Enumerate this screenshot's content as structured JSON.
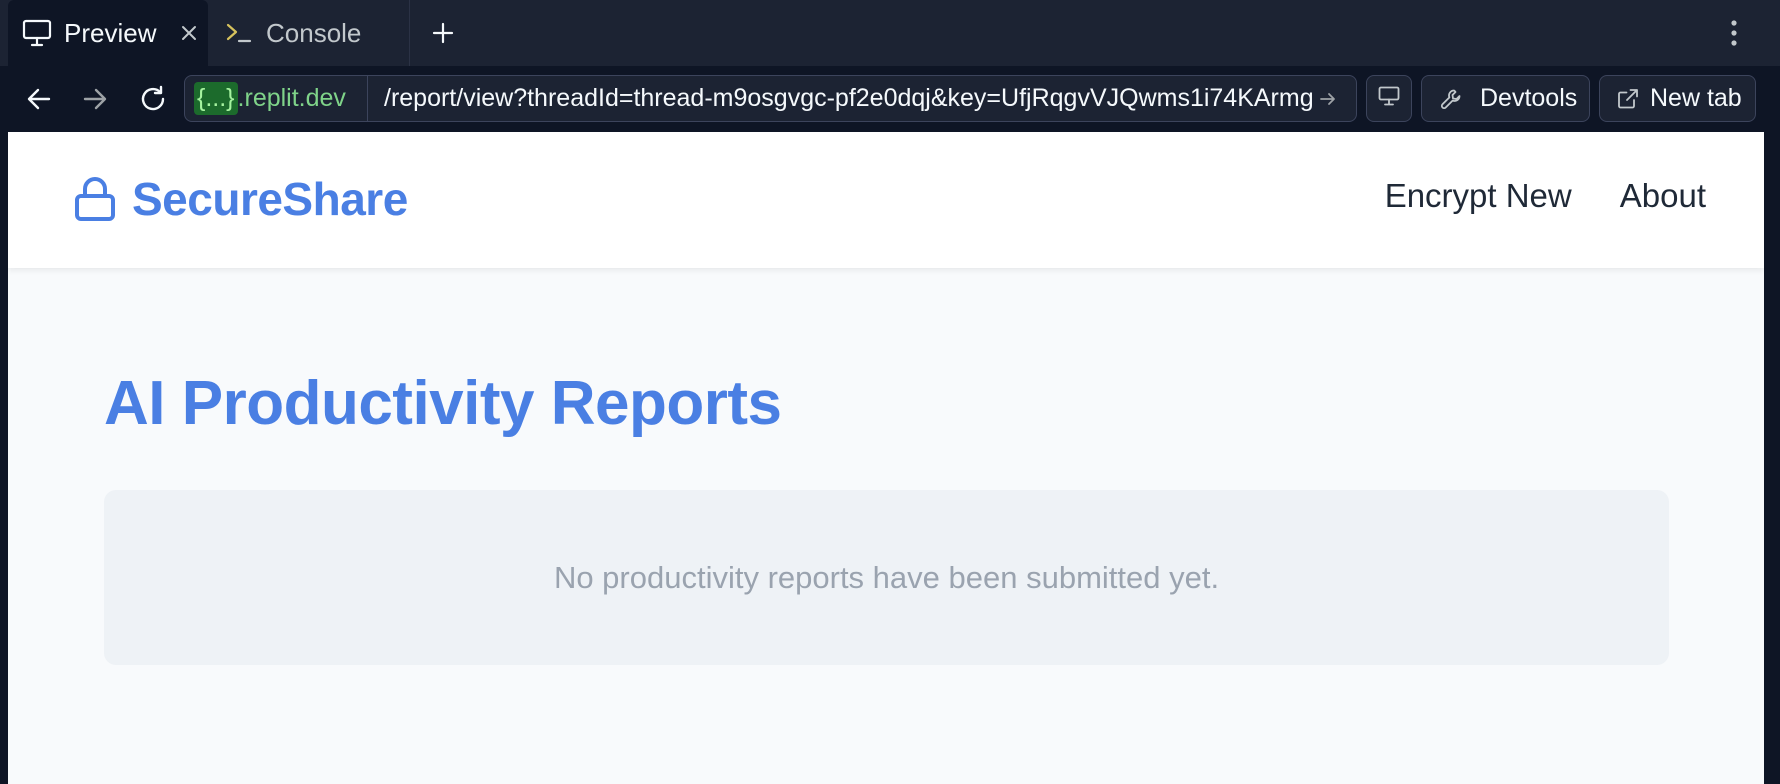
{
  "tabs": [
    {
      "label": "Preview",
      "icon": "monitor-icon",
      "active": true
    },
    {
      "label": "Console",
      "icon": "terminal-icon",
      "active": false
    }
  ],
  "address_bar": {
    "host_curly": "{...}",
    "host_domain": ".replit.dev",
    "path": "/report/view?threadId=thread-m9osgvgc-pf2e0dqj&key=UfjRqgvVJQwms1i74KArmg"
  },
  "toolbar": {
    "devtools_label": "Devtools",
    "new_tab_label": "New tab"
  },
  "site": {
    "brand": "SecureShare",
    "nav": [
      "Encrypt New",
      "About"
    ],
    "page_title": "AI Productivity Reports",
    "empty_message": "No productivity reports have been submitted yet."
  },
  "colors": {
    "brand": "#4a7fe3",
    "chrome_dark": "#0e1525",
    "chrome_panel": "#1c2333"
  }
}
